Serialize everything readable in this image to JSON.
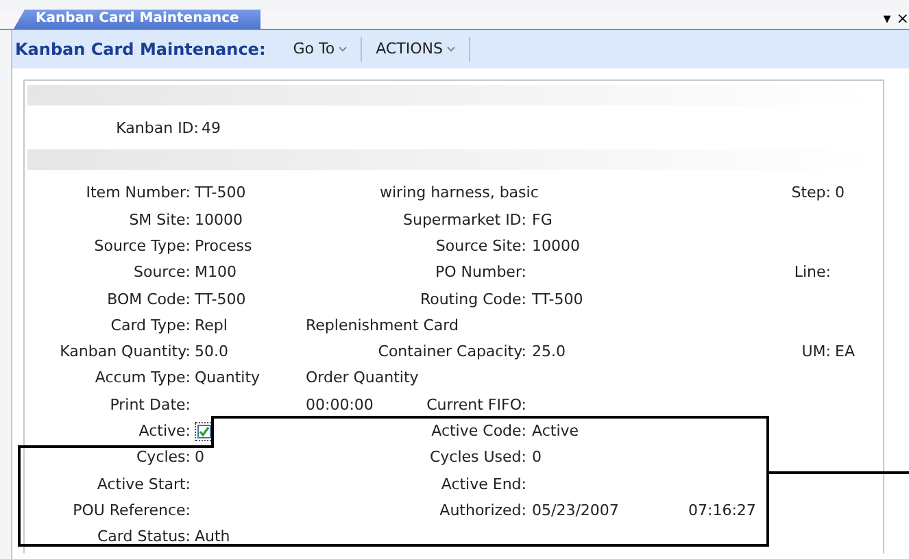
{
  "tab": {
    "label": "Kanban Card Maintenance",
    "selected": true
  },
  "window_controls": [
    "▾",
    "×"
  ],
  "toolbar": {
    "title": "Kanban Card Maintenance:",
    "menus": [
      {
        "label": "Go To"
      },
      {
        "label": "ACTIONS"
      }
    ]
  },
  "kanban_id": {
    "label": "Kanban ID:",
    "value": "49"
  },
  "rows": [
    {
      "left": {
        "label": "Item Number:",
        "value": "TT-500"
      },
      "description": "wiring harness, basic",
      "right": {
        "label": "Step:",
        "value": "0"
      }
    },
    {
      "left": {
        "label": "SM Site:",
        "value": "10000"
      },
      "middle": {
        "label": "Supermarket ID:",
        "value": "FG"
      }
    },
    {
      "left": {
        "label": "Source Type:",
        "value": "Process"
      },
      "middle": {
        "label": "Source Site:",
        "value": "10000"
      }
    },
    {
      "left": {
        "label": "Source:",
        "value": "M100"
      },
      "middle": {
        "label": "PO Number:"
      },
      "right": {
        "label": "Line:"
      }
    },
    {
      "left": {
        "label": "BOM Code:",
        "value": "TT-500"
      },
      "middle": {
        "label": "Routing Code:",
        "value": "TT-500"
      }
    },
    {
      "left": {
        "label": "Card Type:",
        "value": "Repl"
      },
      "description": "Replenishment Card"
    },
    {
      "left": {
        "label": "Kanban Quantity:",
        "value": "50.0"
      },
      "middle": {
        "label": "Container Capacity:",
        "value": "25.0"
      },
      "right": {
        "label": "UM:",
        "value": "EA"
      }
    },
    {
      "left": {
        "label": "Accum Type:",
        "value": "Quantity"
      },
      "description": "Order Quantity"
    },
    {
      "left": {
        "label": "Print Date:"
      },
      "description": "00:00:00",
      "middle": {
        "label": "Current FIFO:"
      }
    },
    {
      "left": {
        "label": "Active:",
        "checked": true
      },
      "middle": {
        "label": "Active Code:",
        "value": "Active"
      }
    },
    {
      "left": {
        "label": "Cycles:",
        "value": "0"
      },
      "middle": {
        "label": "Cycles Used:",
        "value": "0"
      }
    },
    {
      "left": {
        "label": "Active Start:"
      },
      "middle": {
        "label": "Active End:"
      }
    },
    {
      "left": {
        "label": "POU Reference:"
      },
      "middle": {
        "label": "Authorized:",
        "value": "05/23/2007"
      },
      "time": "07:16:27"
    },
    {
      "left": {
        "label": "Card Status:",
        "value": "Auth"
      }
    }
  ]
}
